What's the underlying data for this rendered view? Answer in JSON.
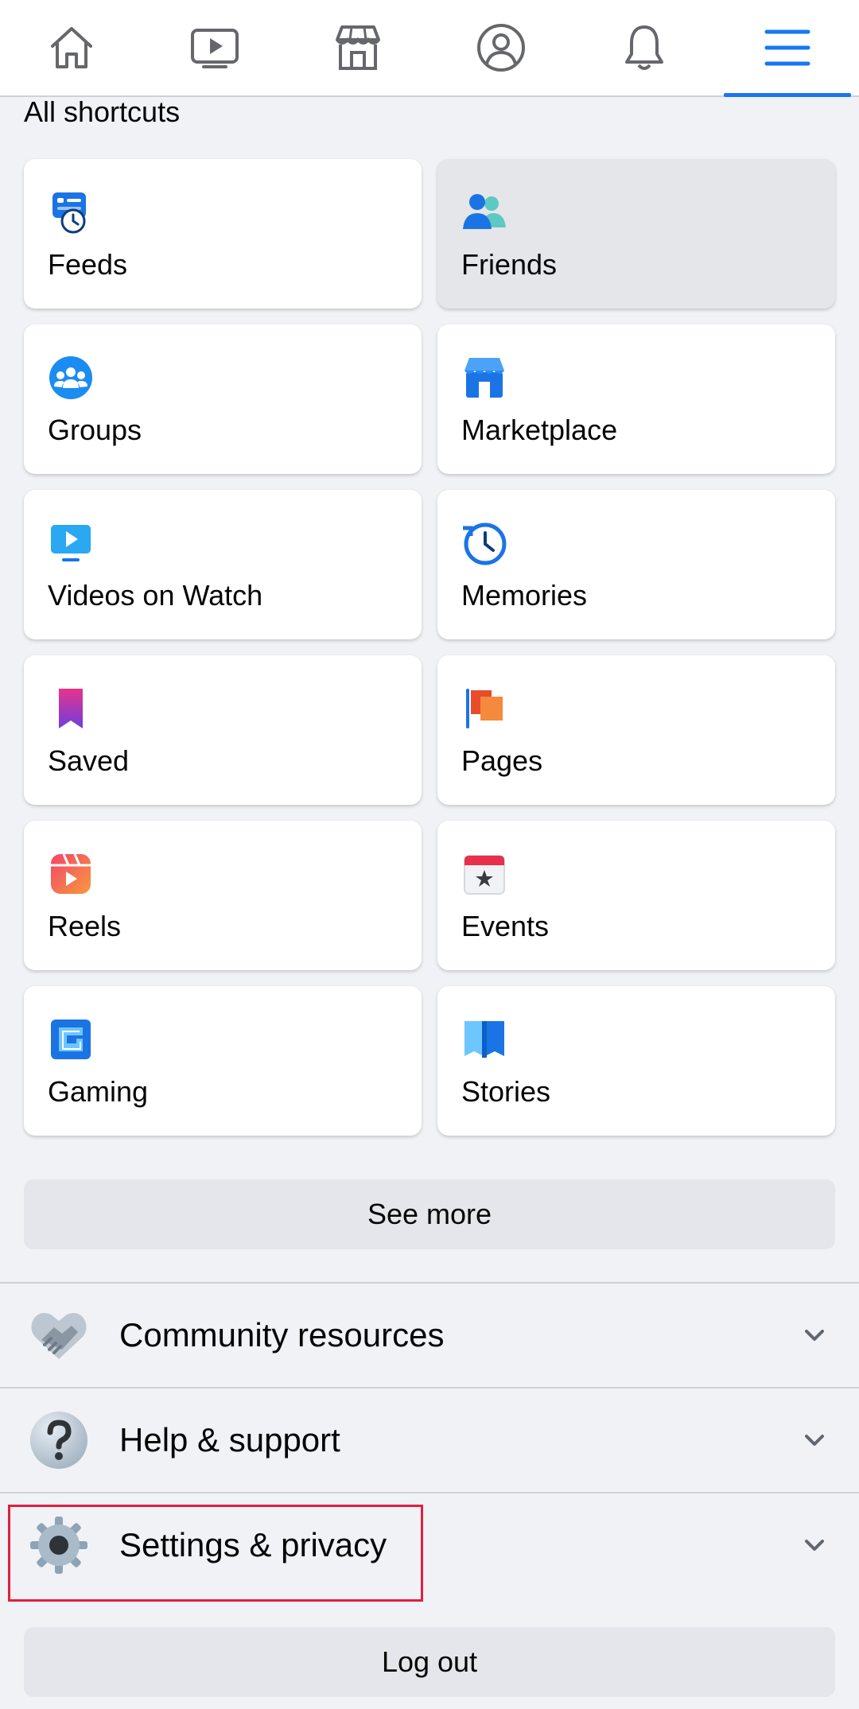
{
  "nav": {
    "tabs": [
      {
        "name": "home-icon",
        "active": false
      },
      {
        "name": "watch-icon",
        "active": false
      },
      {
        "name": "marketplace-icon",
        "active": false
      },
      {
        "name": "profile-icon",
        "active": false
      },
      {
        "name": "notifications-bell-icon",
        "active": false
      },
      {
        "name": "menu-hamburger-icon",
        "active": true
      }
    ],
    "accent_color": "#1877f2"
  },
  "shortcuts": {
    "title": "All shortcuts",
    "items": [
      {
        "label": "Feeds",
        "icon": "feeds-icon"
      },
      {
        "label": "Friends",
        "icon": "friends-icon"
      },
      {
        "label": "Groups",
        "icon": "groups-icon"
      },
      {
        "label": "Marketplace",
        "icon": "marketplace-shop-icon"
      },
      {
        "label": "Videos on Watch",
        "icon": "video-icon"
      },
      {
        "label": "Memories",
        "icon": "memories-clock-icon"
      },
      {
        "label": "Saved",
        "icon": "bookmark-icon"
      },
      {
        "label": "Pages",
        "icon": "pages-flag-icon"
      },
      {
        "label": "Reels",
        "icon": "reels-icon"
      },
      {
        "label": "Events",
        "icon": "events-calendar-icon"
      },
      {
        "label": "Gaming",
        "icon": "gaming-icon"
      },
      {
        "label": "Stories",
        "icon": "stories-book-icon"
      }
    ]
  },
  "see_more_label": "See more",
  "sections": [
    {
      "label": "Community resources",
      "icon": "handshake-icon"
    },
    {
      "label": "Help & support",
      "icon": "question-mark-icon"
    },
    {
      "label": "Settings & privacy",
      "icon": "gear-icon"
    }
  ],
  "logout_label": "Log out"
}
